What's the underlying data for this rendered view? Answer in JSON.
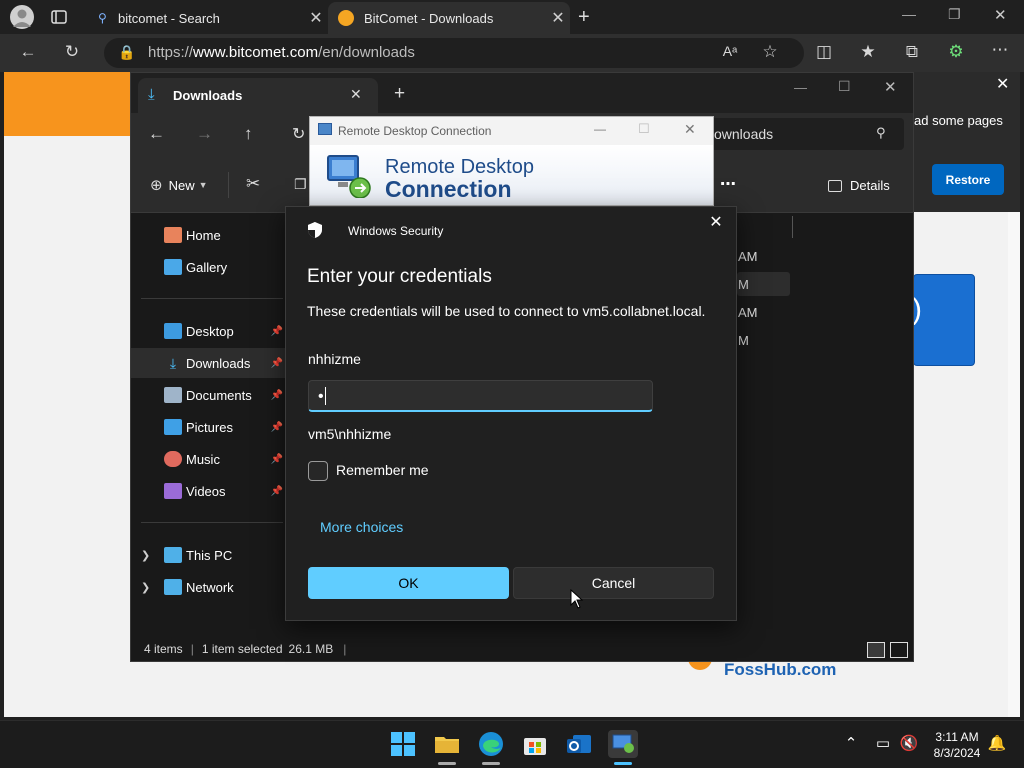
{
  "browser": {
    "tabs": [
      {
        "label": "bitcomet - Search"
      },
      {
        "label": "BitComet - Downloads"
      }
    ],
    "url_prefix": "https://",
    "url_domain": "www.bitcomet.com",
    "url_path": "/en/downloads"
  },
  "webpage": {
    "restore_text": "ad some pages",
    "restore_button": "Restore",
    "fosshub_text": "FossHub.com"
  },
  "explorer": {
    "tab_label": "Downloads",
    "search_text": "ownloads",
    "cmd_new": "New",
    "cmd_details": "Details",
    "nav": {
      "home": "Home",
      "gallery": "Gallery",
      "desktop": "Desktop",
      "downloads": "Downloads",
      "documents": "Documents",
      "pictures": "Pictures",
      "music": "Music",
      "videos": "Videos",
      "this_pc": "This PC",
      "network": "Network"
    },
    "row_fragments": [
      "AM",
      "M",
      "AM",
      "M"
    ],
    "status": {
      "items": "4 items",
      "selected": "1 item selected",
      "size": "26.1 MB"
    }
  },
  "rdc": {
    "title": "Remote Desktop Connection",
    "heading_line1": "Remote Desktop",
    "heading_line2": "Connection"
  },
  "security_dialog": {
    "app_title": "Windows Security",
    "heading": "Enter your credentials",
    "description": "These credentials will be used to connect to vm5.collabnet.local.",
    "username": "nhhizme",
    "password_mask": "•",
    "domain_user": "vm5\\nhhizme",
    "remember_label": "Remember me",
    "more_choices": "More choices",
    "ok_label": "OK",
    "cancel_label": "Cancel"
  },
  "taskbar": {
    "time": "3:11 AM",
    "date": "8/3/2024"
  }
}
